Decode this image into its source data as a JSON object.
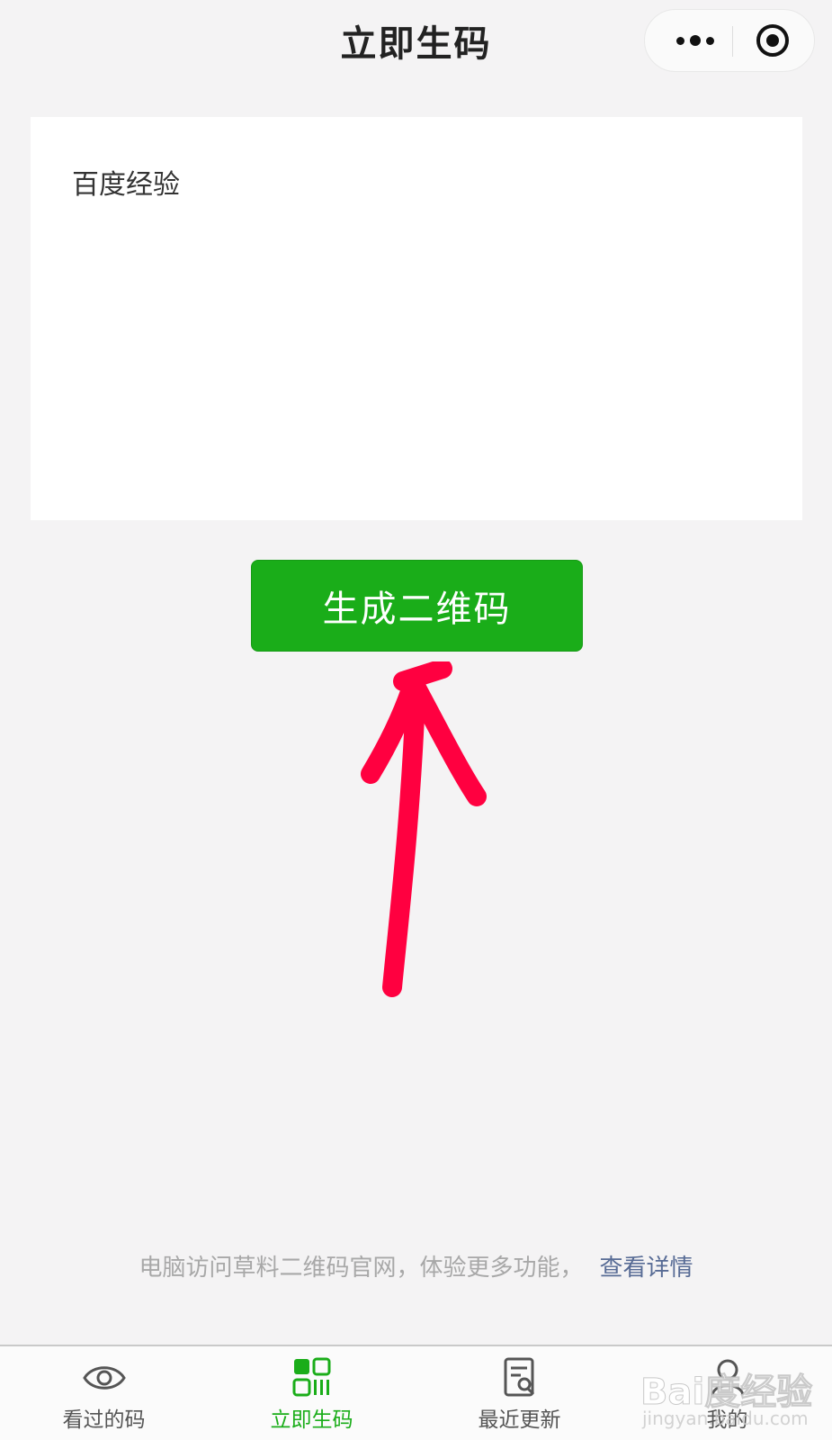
{
  "header": {
    "title": "立即生码"
  },
  "input": {
    "value": "百度经验"
  },
  "actions": {
    "generate_label": "生成二维码"
  },
  "footer": {
    "note": "电脑访问草料二维码官网，体验更多功能，",
    "link": "查看详情"
  },
  "tabbar": {
    "items": [
      {
        "label": "看过的码",
        "icon": "eye-icon",
        "active": false
      },
      {
        "label": "立即生码",
        "icon": "qr-code-icon",
        "active": true
      },
      {
        "label": "最近更新",
        "icon": "document-search-icon",
        "active": false
      },
      {
        "label": "我的",
        "icon": "user-icon",
        "active": false
      }
    ]
  },
  "watermark": {
    "main": "Bai度经验",
    "sub": "jingyan.baidu.com"
  },
  "colors": {
    "accent": "#1aad19",
    "link": "#576b95",
    "annotation_arrow": "#ff0040"
  }
}
